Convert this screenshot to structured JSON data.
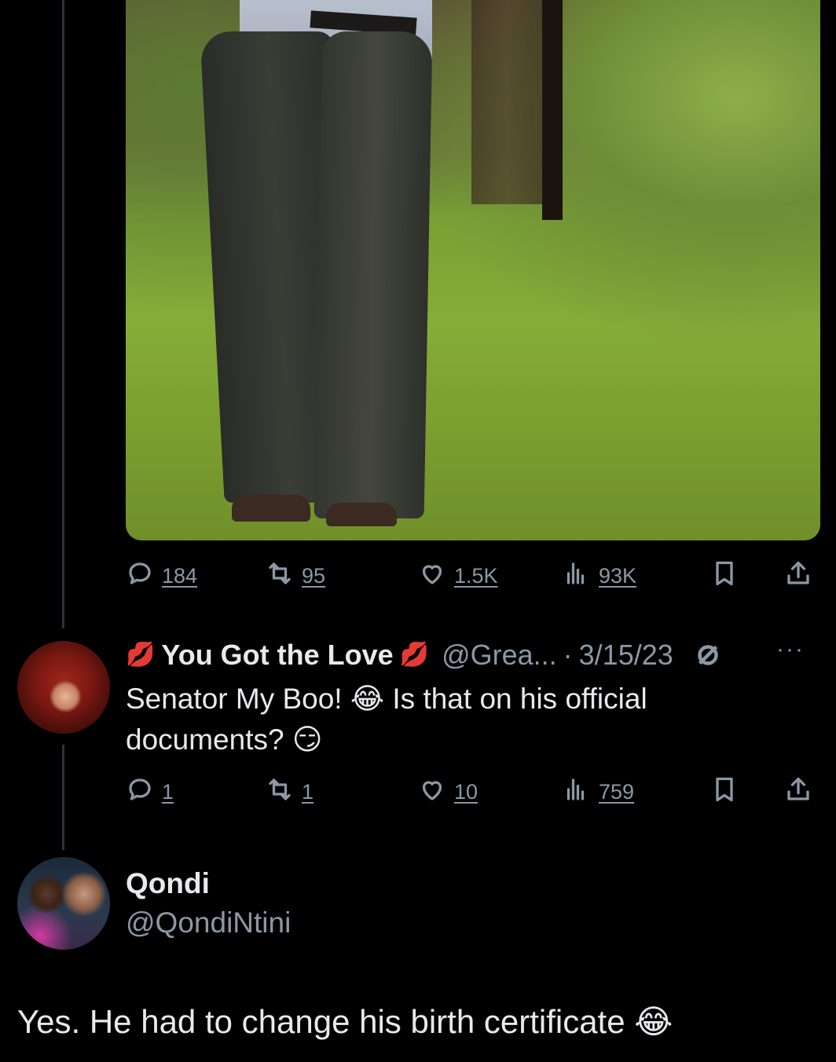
{
  "tweet": {
    "stats": {
      "replies": "184",
      "reposts": "95",
      "likes": "1.5K",
      "views": "93K"
    }
  },
  "reply": {
    "name_prefix_emoji": "💋",
    "display_name": "You Got the Love",
    "name_suffix_emoji": "💋",
    "handle": "@Grea...",
    "separator": "·",
    "date": "3/15/23",
    "more": "···",
    "text_part1": "Senator My Boo! ",
    "emoji1": "😂",
    "text_part2": " Is that on his official documents? ",
    "emoji2": "😏",
    "stats": {
      "replies": "1",
      "reposts": "1",
      "likes": "10",
      "views": "759"
    }
  },
  "main": {
    "display_name": "Qondi",
    "handle": "@QondiNtini",
    "text": "Yes. He had to change his birth certificate ",
    "emoji": "😂"
  },
  "icons": [
    "reply-icon",
    "repost-icon",
    "like-icon",
    "views-icon",
    "bookmark-icon",
    "share-icon",
    "mute-icon"
  ],
  "colors": {
    "background": "#000000",
    "text": "#e7e9ea",
    "muted": "#8b98a5",
    "thread_line": "#2f3336"
  }
}
